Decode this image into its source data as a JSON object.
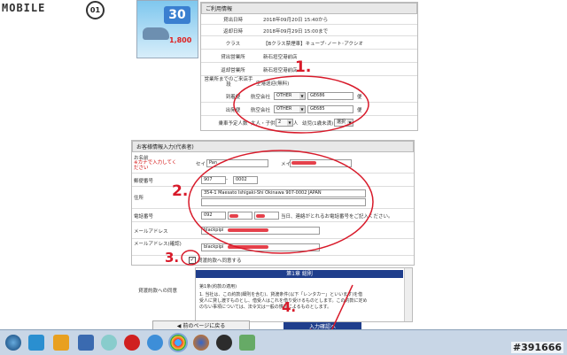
{
  "watermark": {
    "text": "MOBILE",
    "badge": "01"
  },
  "ad": {
    "discount": "30",
    "price": "1,800"
  },
  "usage": {
    "title": "ご利用情報",
    "rows": [
      {
        "label": "貸出日時",
        "value": "2018年09月20日 15:40から"
      },
      {
        "label": "返却日時",
        "value": "2018年09月29日 15:00まで"
      },
      {
        "label": "クラス",
        "value": "【Bクラス禁煙車】キューブ･ノート･アクシオ"
      },
      {
        "label": "貸出営業所",
        "value": "新石垣空港前店"
      },
      {
        "label": "返却営業所",
        "value": "新石垣空港前店"
      },
      {
        "label": "営業所までのご来店手段",
        "value": "空港送迎(無料)"
      }
    ],
    "arrival": {
      "label": "到着便",
      "prefix": "航空会社",
      "airline": "OTHER",
      "flight": "GE686",
      "suffix": "便"
    },
    "departure": {
      "label": "出発便",
      "prefix": "航空会社",
      "airline": "OTHER",
      "flight": "GE685",
      "suffix": "便"
    },
    "passengers": {
      "label": "乗車予定人数",
      "adults_label": "大人・子供",
      "adults": "2",
      "unit": "人",
      "infants_label": "幼児(1歳未満)",
      "infants": "選択"
    }
  },
  "customer": {
    "title": "お客様情報入力(代表者)",
    "name_label": "お名前",
    "name_note": "※カナで入力してください",
    "name_prefix": "セイ",
    "name_value": "Pan",
    "name_mei": "メイ",
    "zip_label": "郵便番号",
    "zip1": "907",
    "zip_sep": "-",
    "zip2": "0002",
    "address_label": "住所",
    "address_value": "354-1 Maesato Ishigaki-Shi Okinawa 907-0002 JAPAN",
    "phone_label": "電話番号",
    "phone1": "092",
    "phone_note": "当日、連絡がとれるお電話番号をご記入ください。",
    "email_label": "メールアドレス",
    "email_value": "blackpipi",
    "email_confirm_label": "メールアドレス(確認)",
    "email_confirm_value": "blackpipi"
  },
  "agree": {
    "checkbox_label": "貸渡約款へ同意する",
    "section_label": "貸渡約款への同意"
  },
  "terms": {
    "heading": "第1章 総則",
    "article": "第1条(約款の適用)",
    "line1": "1. 当社は、この約款(細則を含む)、貸渡条件(以下「レンタカー」といいます)を借",
    "line2": "受人に貸し渡すものとし、借受人はこれを借り受けるものとします。この約款に定め",
    "line3": "のない事項については、法令又は一般の慣習によるものとします。"
  },
  "buttons": {
    "back": "前のページに戻る",
    "next": "入力確認へ"
  },
  "annotations": {
    "a1": "1.",
    "a2": "2.",
    "a3": "3.",
    "a4": "4."
  },
  "photo_id": "#391666",
  "colors": {
    "annotation": "#d81a2a",
    "navy": "#1f3e8c",
    "taskbar": "#c8d6e6"
  }
}
